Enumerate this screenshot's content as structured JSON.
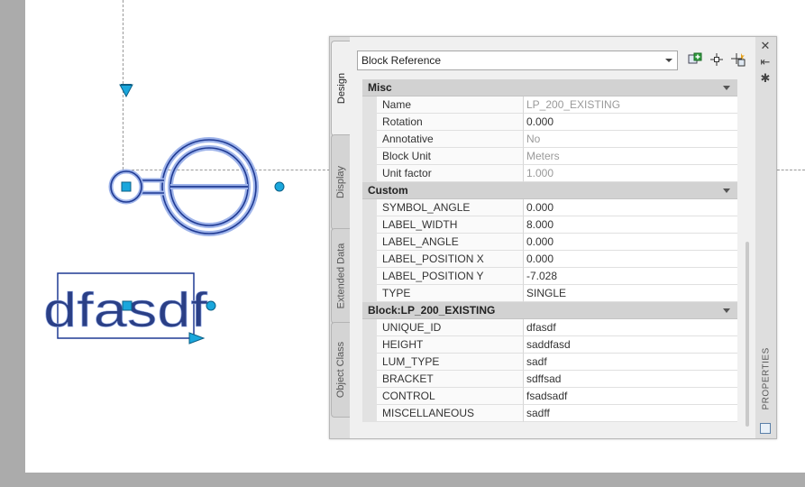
{
  "drawing": {
    "text_entity": "dfasdf"
  },
  "palette": {
    "title": "PROPERTIES",
    "tabs": [
      {
        "label": "Design"
      },
      {
        "label": "Display"
      },
      {
        "label": "Extended Data"
      },
      {
        "label": "Object Class"
      }
    ],
    "selection": "Block Reference",
    "toolbar": {
      "add_icon": "add-to-selection-icon",
      "pick_icon": "select-objects-icon",
      "quickselect_icon": "quick-select-icon"
    },
    "sections": [
      {
        "title": "Misc",
        "rows": [
          {
            "name": "Name",
            "value": "LP_200_EXISTING",
            "readonly": true
          },
          {
            "name": "Rotation",
            "value": "0.000",
            "readonly": false
          },
          {
            "name": "Annotative",
            "value": "No",
            "readonly": true
          },
          {
            "name": "Block Unit",
            "value": "Meters",
            "readonly": true
          },
          {
            "name": "Unit factor",
            "value": "1.000",
            "readonly": true
          }
        ]
      },
      {
        "title": "Custom",
        "rows": [
          {
            "name": "SYMBOL_ANGLE",
            "value": "0.000",
            "readonly": false
          },
          {
            "name": "LABEL_WIDTH",
            "value": "8.000",
            "readonly": false
          },
          {
            "name": "LABEL_ANGLE",
            "value": "0.000",
            "readonly": false
          },
          {
            "name": "LABEL_POSITION X",
            "value": "0.000",
            "readonly": false
          },
          {
            "name": "LABEL_POSITION Y",
            "value": "-7.028",
            "readonly": false
          },
          {
            "name": "TYPE",
            "value": "SINGLE",
            "readonly": false
          }
        ]
      },
      {
        "title": "Block:LP_200_EXISTING",
        "rows": [
          {
            "name": "UNIQUE_ID",
            "value": "dfasdf",
            "readonly": false
          },
          {
            "name": "HEIGHT",
            "value": "saddfasd",
            "readonly": false
          },
          {
            "name": "LUM_TYPE",
            "value": "sadf",
            "readonly": false
          },
          {
            "name": "BRACKET",
            "value": "sdffsad",
            "readonly": false
          },
          {
            "name": "CONTROL",
            "value": "fsadsadf",
            "readonly": false
          },
          {
            "name": "MISCELLANEOUS",
            "value": "sadff",
            "readonly": false
          }
        ]
      }
    ]
  },
  "colors": {
    "entity": "#1f3a93",
    "grip": "#1aa7dc",
    "highlight": "#4a6fd0"
  }
}
